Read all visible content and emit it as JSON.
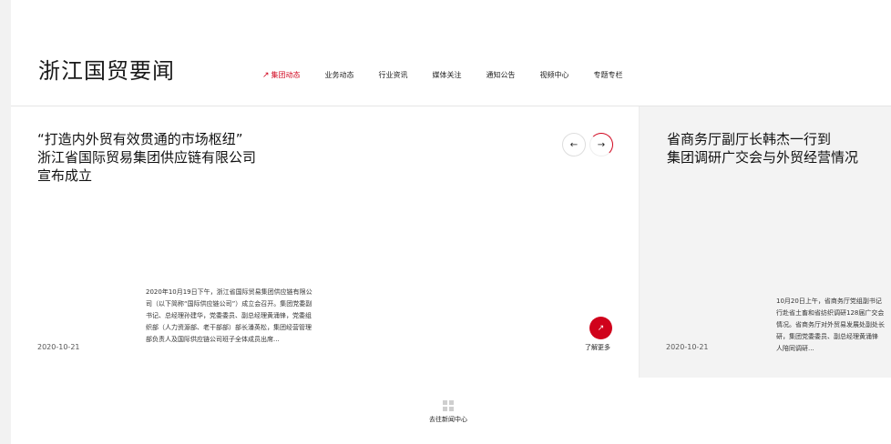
{
  "header": {
    "title": "浙江国贸要闻",
    "nav": [
      {
        "label": "集团动态",
        "active": true
      },
      {
        "label": "业务动态"
      },
      {
        "label": "行业资讯"
      },
      {
        "label": "媒体关注"
      },
      {
        "label": "通知公告"
      },
      {
        "label": "视频中心"
      },
      {
        "label": "专题专栏"
      }
    ]
  },
  "news": {
    "main": {
      "headline_lines": [
        "“打造内外贸有效贯通的市场枢纽”",
        "浙江省国际贸易集团供应链有限公司",
        "宣布成立"
      ],
      "summary": "2020年10月19日下午，浙江省国际贸易集团供应链有限公司（以下简称“国际供应链公司”）成立会召开。集团党委副书记、总经理孙建华，党委委员、副总经理黄涌锋，党委组织部（人力资源部、老干部部）部长潘英松，集团经营管理部负责人及国际供应链公司班子全体成员出席...",
      "date": "2020-10-21",
      "more_label": "了解更多"
    },
    "side": {
      "headline_lines": [
        "省商务厅副厅长韩杰一行到",
        "集团调研广交会与外贸经营情况"
      ],
      "summary_lines": [
        "10月20日上午，省商务厅党组副书记",
        "行赴省土畜和省纺织调研128届广交会",
        "情况。省商务厅对外贸易发展处副处长",
        "研，集团党委委员、副总经理黄涌锋",
        "人陪同调研..."
      ],
      "date": "2020-10-21"
    },
    "controls": {
      "prev_icon": "←",
      "next_icon": "→",
      "more_icon": "↗"
    }
  },
  "footer": {
    "link_label": "去往新闻中心"
  },
  "colors": {
    "accent": "#d0021b"
  }
}
